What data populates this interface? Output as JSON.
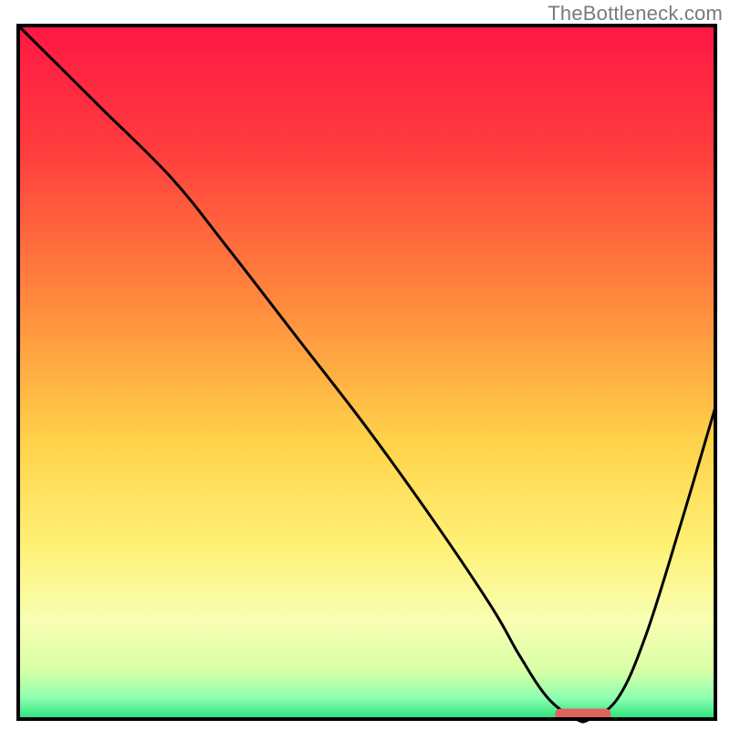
{
  "watermark": {
    "text": "TheBottleneck.com"
  },
  "chart_data": {
    "type": "line",
    "title": "",
    "xlabel": "",
    "ylabel": "",
    "xlim": [
      0,
      100
    ],
    "ylim": [
      0,
      100
    ],
    "x": [
      0,
      5,
      12,
      22,
      30,
      40,
      50,
      60,
      68,
      72,
      76,
      80,
      82,
      86,
      90,
      95,
      100
    ],
    "values": [
      100,
      95,
      88,
      78,
      68,
      55,
      42,
      28,
      16,
      9,
      3,
      0,
      0,
      3,
      12,
      28,
      45
    ],
    "optimal_marker": {
      "x_start": 77,
      "x_end": 85,
      "y": 0.7
    },
    "gradient_stops": [
      {
        "offset": 0,
        "color": "#ff1744"
      },
      {
        "offset": 18,
        "color": "#ff3d3d"
      },
      {
        "offset": 40,
        "color": "#ff8a3d"
      },
      {
        "offset": 60,
        "color": "#ffd24a"
      },
      {
        "offset": 75,
        "color": "#fff176"
      },
      {
        "offset": 86,
        "color": "#f7ffb3"
      },
      {
        "offset": 93,
        "color": "#d8ffa6"
      },
      {
        "offset": 97,
        "color": "#8cffb0"
      },
      {
        "offset": 100,
        "color": "#26e07a"
      }
    ],
    "frame_color": "#000000",
    "line_color": "#000000",
    "marker_color": "#e0615f"
  }
}
